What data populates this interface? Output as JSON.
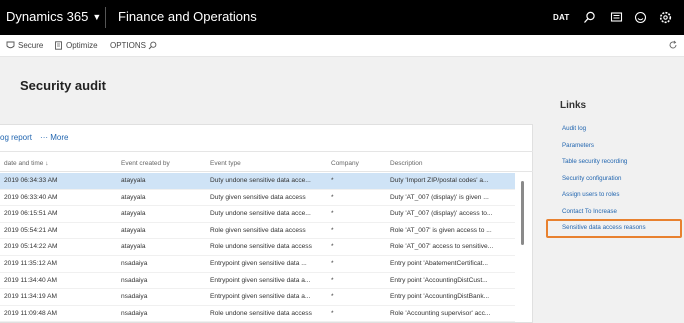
{
  "topbar": {
    "app_name": "Dynamics 365",
    "module": "Finance and Operations",
    "company": "DAT"
  },
  "actionbar": {
    "secure": "Secure",
    "optimize": "Optimize",
    "options": "OPTIONS"
  },
  "page": {
    "title": "Security audit"
  },
  "card": {
    "tab": "og report",
    "more": "··· More"
  },
  "grid": {
    "headers": {
      "date": "date and time ↓",
      "created_by": "Event created by",
      "type": "Event type",
      "company": "Company",
      "description": "Description"
    },
    "rows": [
      {
        "date": "2019 06:34:33 AM",
        "user": "atayyala",
        "type": "Duty undone sensitive data acce...",
        "company": "*",
        "desc": "Duty 'Import ZIP/postal codes' a..."
      },
      {
        "date": "2019 06:33:40 AM",
        "user": "atayyala",
        "type": "Duty given sensitive data access",
        "company": "*",
        "desc": "Duty 'AT_007 (display)' is given ..."
      },
      {
        "date": "2019 06:15:51 AM",
        "user": "atayyala",
        "type": "Duty undone sensitive data acce...",
        "company": "*",
        "desc": "Duty 'AT_007 (display)' access to..."
      },
      {
        "date": "2019 05:54:21 AM",
        "user": "atayyala",
        "type": "Role given sensitive data access",
        "company": "*",
        "desc": "Role 'AT_007' is given access to ..."
      },
      {
        "date": "2019 05:14:22 AM",
        "user": "atayyala",
        "type": "Role undone sensitive data access",
        "company": "*",
        "desc": "Role 'AT_007' access to sensitive..."
      },
      {
        "date": "2019 11:35:12 AM",
        "user": "nsadaiya",
        "type": "Entrypoint given sensitive data ...",
        "company": "*",
        "desc": "Entry point 'AbatementCertificat..."
      },
      {
        "date": "2019 11:34:40 AM",
        "user": "nsadaiya",
        "type": "Entrypoint given sensitive data a...",
        "company": "*",
        "desc": "Entry point 'AccountingDistCust..."
      },
      {
        "date": "2019 11:34:19 AM",
        "user": "nsadaiya",
        "type": "Entrypoint given sensitive data a...",
        "company": "*",
        "desc": "Entry point 'AccountingDistBank..."
      },
      {
        "date": "2019 11:09:48 AM",
        "user": "nsadaiya",
        "type": "Role undone sensitive data access",
        "company": "*",
        "desc": "Role 'Accounting supervisor' acc..."
      }
    ]
  },
  "links": {
    "title": "Links",
    "items": [
      "Audit log",
      "Parameters",
      "Table security recording",
      "Security configuration",
      "Assign users to roles",
      "Contact To Increase",
      "Sensitive data access reasons"
    ]
  },
  "colors": {
    "topbar": "#000000",
    "link": "#2266b0",
    "selected_row": "#cfe3f6",
    "highlight": "#e8812f"
  }
}
